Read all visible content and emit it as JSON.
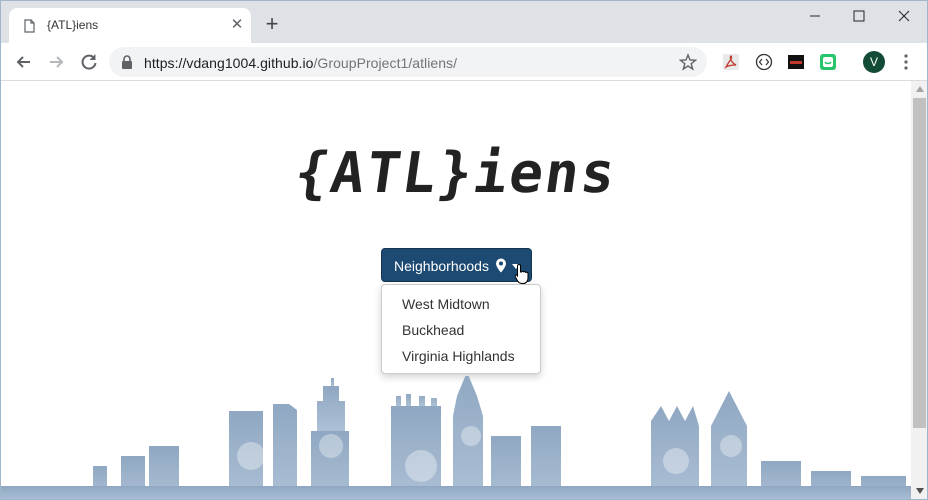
{
  "browser": {
    "tab_title": "{ATL}iens",
    "url_host": "https://vdang1004.github.io",
    "url_path": "/GroupProject1/atliens/",
    "profile_initial": "V"
  },
  "page": {
    "logo_text": "{ATL}iens",
    "dropdown": {
      "label": "Neighborhoods",
      "items": [
        "West Midtown",
        "Buckhead",
        "Virginia Highlands"
      ]
    }
  },
  "icons": {
    "tab": "document-icon",
    "lock": "lock-icon",
    "bookmark": "star-icon",
    "dropdown": "map-pin-icon",
    "cursor": "hand-pointer-icon"
  },
  "colors": {
    "button_bg": "#1d4a72",
    "skyline": "#8fa7c2"
  }
}
